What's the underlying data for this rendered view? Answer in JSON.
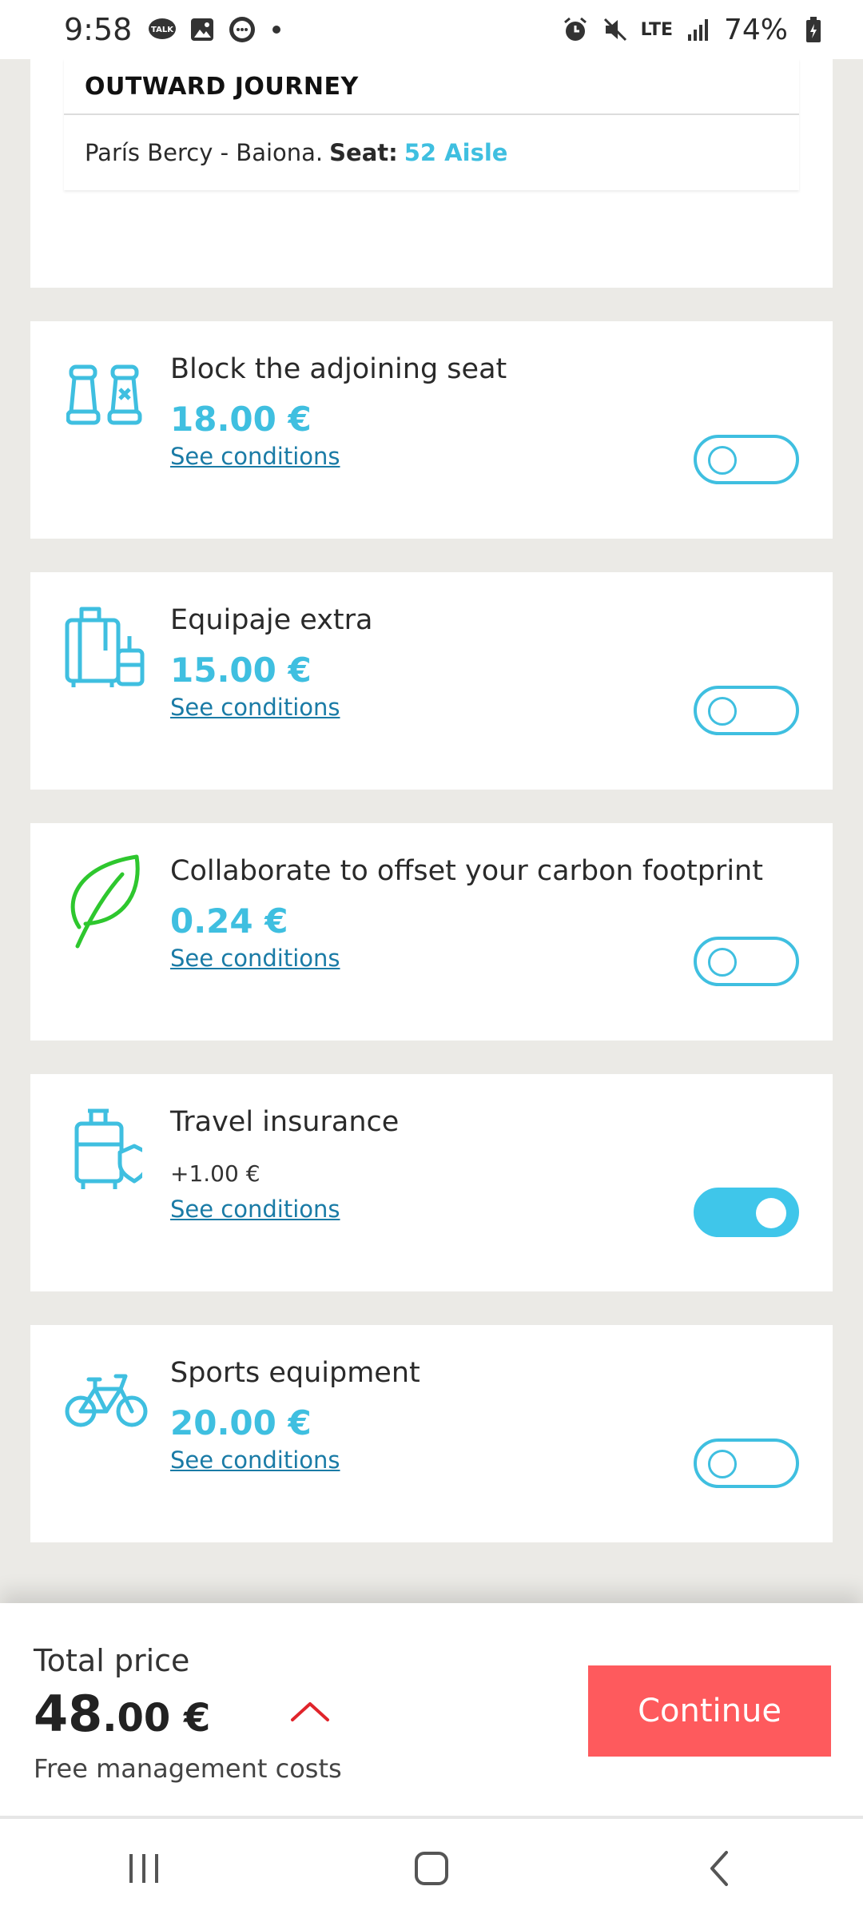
{
  "status_bar": {
    "time": "9:58",
    "network": "LTE",
    "battery": "74%",
    "icons": [
      "talk-icon",
      "gallery-icon",
      "messages-icon",
      "alarm-icon",
      "mute-icon",
      "signal-icon",
      "battery-icon"
    ]
  },
  "journey": {
    "title": "OUTWARD JOURNEY",
    "route": "París Bercy - Baiona.",
    "seat_label": "Seat:",
    "seat_value": "52 Aisle"
  },
  "extras": [
    {
      "icon": "seats-icon",
      "title": "Block the adjoining seat",
      "price": "18.00 €",
      "link": "See conditions",
      "enabled": false
    },
    {
      "icon": "luggage-icon",
      "title": "Equipaje extra",
      "price": "15.00 €",
      "link": "See conditions",
      "enabled": false
    },
    {
      "icon": "leaf-icon",
      "title": "Collaborate to offset your carbon footprint",
      "price": "0.24 €",
      "link": "See conditions",
      "enabled": false
    },
    {
      "icon": "insurance-luggage-icon",
      "title": "Travel insurance",
      "price": "+1.00 €",
      "link": "See conditions",
      "enabled": true
    },
    {
      "icon": "bicycle-icon",
      "title": "Sports equipment",
      "price": "20.00 €",
      "link": "See conditions",
      "enabled": false
    }
  ],
  "footer": {
    "total_label": "Total price",
    "total_int": "48",
    "total_dec": ".00 €",
    "note": "Free management costs",
    "continue_label": "Continue"
  },
  "colors": {
    "accent": "#3fbfe0",
    "link": "#1a7ba6",
    "continue": "#fe5a5d",
    "leaf": "#2ec72e",
    "background": "#ebeae6"
  }
}
